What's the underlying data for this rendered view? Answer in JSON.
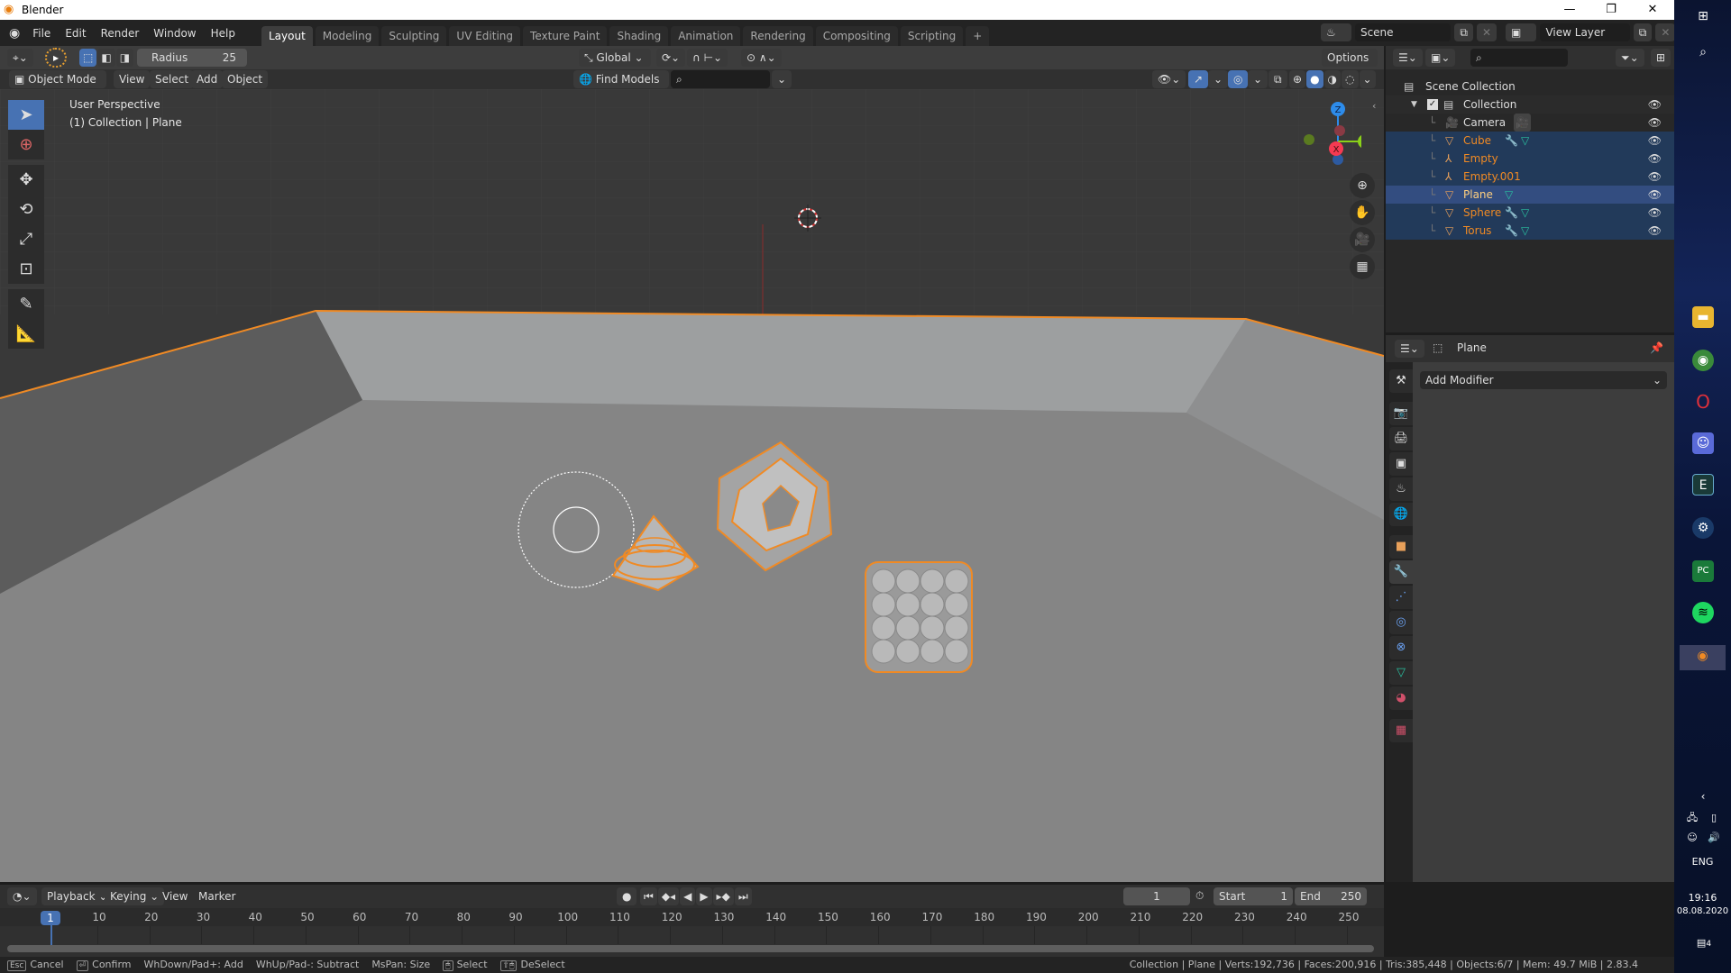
{
  "window": {
    "title": "Blender",
    "controls": [
      "—",
      "❐",
      "✕"
    ]
  },
  "menubar": {
    "items": [
      "File",
      "Edit",
      "Render",
      "Window",
      "Help"
    ],
    "workspace_tabs": [
      "Layout",
      "Modeling",
      "Sculpting",
      "UV Editing",
      "Texture Paint",
      "Shading",
      "Animation",
      "Rendering",
      "Compositing",
      "Scripting"
    ],
    "active_tab": "Layout",
    "add_tab": "+",
    "scene": "Scene",
    "view_layer": "View Layer"
  },
  "tool_header": {
    "radius_label": "Radius",
    "radius_value": "25",
    "orientation": "Global",
    "options": "Options"
  },
  "view_header": {
    "mode": "Object Mode",
    "menus": [
      "View",
      "Select",
      "Add",
      "Object"
    ],
    "find_models": "Find Models",
    "search_placeholder": ""
  },
  "viewport": {
    "perspective": "User Perspective",
    "context": "(1) Collection | Plane",
    "gizmo": {
      "x": "X",
      "y": "Y",
      "z": "Z"
    },
    "colors": {
      "x": "#f53a52",
      "y": "#8ad119",
      "z": "#2d8ceb",
      "selected": "#f08a24"
    }
  },
  "outliner": {
    "search_placeholder": "",
    "root": "Scene Collection",
    "collection": "Collection",
    "items": [
      {
        "name": "Camera",
        "type": "camera",
        "state": "normal"
      },
      {
        "name": "Cube",
        "type": "mesh",
        "state": "selected",
        "modifier": true
      },
      {
        "name": "Empty",
        "type": "empty",
        "state": "selected"
      },
      {
        "name": "Empty.001",
        "type": "empty",
        "state": "selected"
      },
      {
        "name": "Plane",
        "type": "mesh",
        "state": "active",
        "modifier": false
      },
      {
        "name": "Sphere",
        "type": "mesh",
        "state": "selected",
        "modifier": true
      },
      {
        "name": "Torus",
        "type": "mesh",
        "state": "selected",
        "modifier": true
      }
    ]
  },
  "properties": {
    "object_name": "Plane",
    "add_modifier": "Add Modifier",
    "tabs": [
      "tool",
      "render",
      "output",
      "view-layer",
      "scene",
      "world",
      "object",
      "modifiers",
      "particles",
      "physics",
      "constraints",
      "data",
      "material",
      "texture"
    ],
    "active_tab": "modifiers"
  },
  "timeline": {
    "menus": [
      "Playback",
      "Keying",
      "View",
      "Marker"
    ],
    "current_frame": "1",
    "start_label": "Start",
    "start": "1",
    "end_label": "End",
    "end": "250",
    "ticks": [
      "10",
      "20",
      "30",
      "40",
      "50",
      "60",
      "70",
      "80",
      "90",
      "100",
      "110",
      "120",
      "130",
      "140",
      "150",
      "160",
      "170",
      "180",
      "190",
      "200",
      "210",
      "220",
      "230",
      "240",
      "250"
    ]
  },
  "statusbar": {
    "hints": [
      {
        "key": "Esc",
        "label": "Cancel"
      },
      {
        "key": "⏎",
        "label": "Confirm"
      },
      {
        "key": "",
        "label": "WhDown/Pad+: Add"
      },
      {
        "key": "",
        "label": "WhUp/Pad-: Subtract"
      },
      {
        "key": "",
        "label": "MsPan: Size"
      },
      {
        "key": "🖱",
        "label": "Select"
      },
      {
        "key": "⇧🖱",
        "label": "DeSelect"
      }
    ],
    "stats": "Collection | Plane | Verts:192,736 | Faces:200,916 | Tris:385,448 | Objects:6/7 | Mem: 49.7 MiB | 2.83.4"
  },
  "taskbar": {
    "language": "ENG",
    "time": "19:16",
    "date": "08.08.2020",
    "notifications": "4"
  }
}
